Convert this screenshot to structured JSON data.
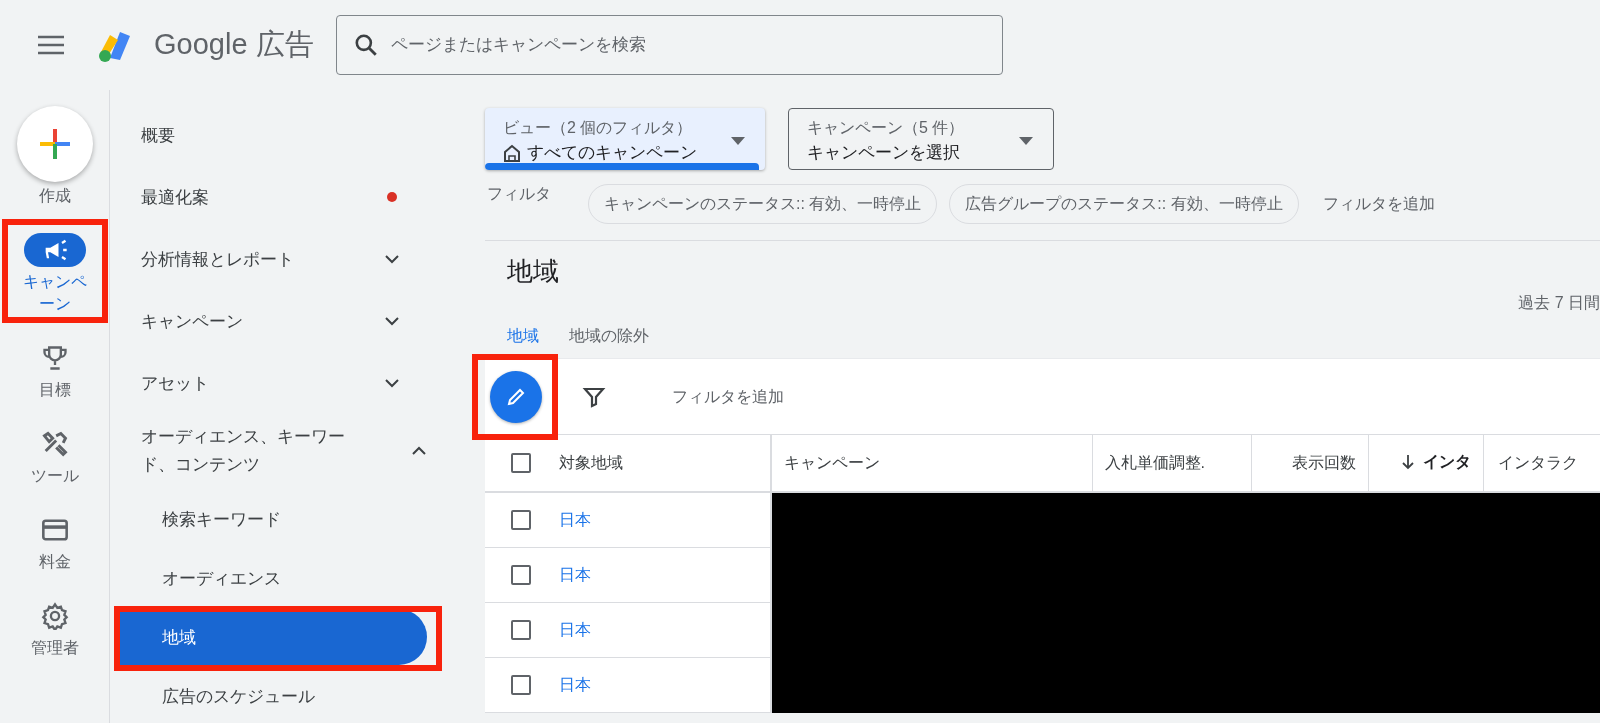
{
  "topbar": {
    "title": "Google 広告",
    "search": {
      "placeholder": "ページまたはキャンペーンを検索"
    }
  },
  "rail": {
    "create_label": "作成",
    "items": [
      {
        "kind": "megaphone",
        "label": "キャンペーン",
        "selected": true,
        "highlighted": true
      },
      {
        "kind": "trophy",
        "label": "目標",
        "selected": false,
        "highlighted": false
      },
      {
        "kind": "tools",
        "label": "ツール",
        "selected": false,
        "highlighted": false
      },
      {
        "kind": "card",
        "label": "料金",
        "selected": false,
        "highlighted": false
      },
      {
        "kind": "gear",
        "label": "管理者",
        "selected": false,
        "highlighted": false
      }
    ]
  },
  "nav": {
    "items": [
      {
        "label": "概要",
        "selected": false
      },
      {
        "label": "最適化案",
        "selected": false,
        "alert": true
      },
      {
        "label": "分析情報とレポート",
        "selected": false,
        "expanded": false
      },
      {
        "label": "キャンペーン",
        "selected": false,
        "expanded": false
      },
      {
        "label": "アセット",
        "selected": false,
        "expanded": false
      },
      {
        "label": "オーディエンス、キーワード、コンテンツ",
        "selected": false,
        "expanded": true,
        "children": [
          {
            "label": "検索キーワード",
            "selected": false,
            "highlighted": false
          },
          {
            "label": "オーディエンス",
            "selected": false,
            "highlighted": false
          },
          {
            "label": "地域",
            "selected": true,
            "highlighted": true
          },
          {
            "label": "広告のスケジュール",
            "selected": false,
            "highlighted": false
          }
        ]
      }
    ]
  },
  "view_selector": {
    "label": "ビュー（2 個のフィルタ）",
    "value": "すべてのキャンペーン",
    "active": true
  },
  "campaign_selector": {
    "label": "キャンペーン（5 件）",
    "value": "キャンペーンを選択",
    "active": false
  },
  "filters": {
    "label": "フィルタ",
    "chips": [
      "キャンペーンのステータス:: 有効、一時停止",
      "広告グループのステータス:: 有効、一時停止"
    ],
    "add": "フィルタを追加"
  },
  "page_title": "地域",
  "date_range": "過去 7 日間",
  "tabs": [
    {
      "label": "地域",
      "selected": true
    },
    {
      "label": "地域の除外",
      "selected": false
    }
  ],
  "toolbar": {
    "edit_highlighted": true,
    "filter_placeholder": "フィルタを追加"
  },
  "table": {
    "header_checked": false,
    "redacted": true,
    "columns": [
      {
        "label": "対象地域",
        "sorted": false
      },
      {
        "label": "キャンペーン",
        "sorted": false
      },
      {
        "label": "入札単価調整.",
        "sorted": false
      },
      {
        "label": "表示回数",
        "sorted": false
      },
      {
        "label": "インタ",
        "sorted": true
      },
      {
        "label": "インタラク",
        "sorted": false
      }
    ],
    "rows": [
      {
        "location": "日本",
        "checked": false
      },
      {
        "location": "日本",
        "checked": false
      },
      {
        "location": "日本",
        "checked": false
      },
      {
        "location": "日本",
        "checked": false
      }
    ]
  }
}
